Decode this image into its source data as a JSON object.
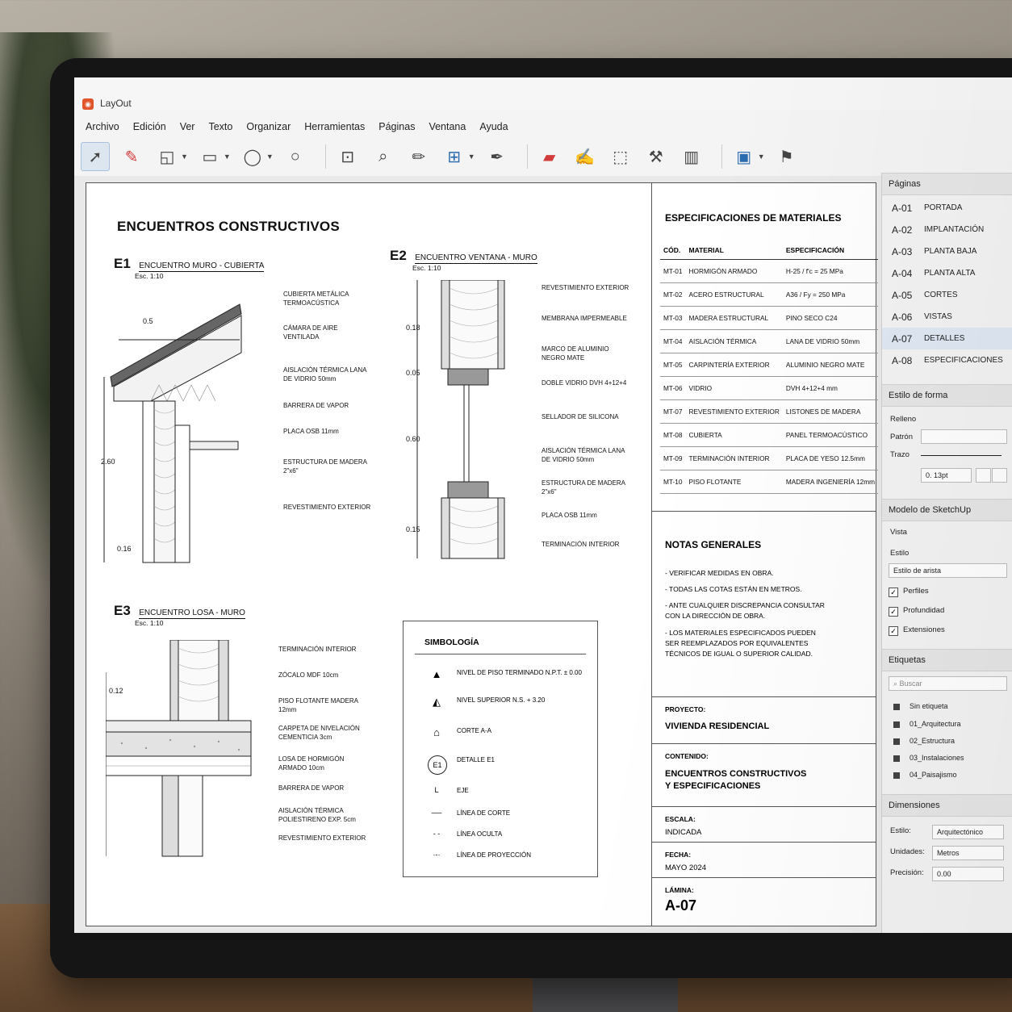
{
  "app": {
    "title": "LayOut"
  },
  "menu": [
    "Archivo",
    "Edición",
    "Ver",
    "Texto",
    "Organizar",
    "Herramientas",
    "Páginas",
    "Ventana",
    "Ayuda"
  ],
  "drawing": {
    "title": "ENCUENTROS CONSTRUCTIVOS",
    "e1": {
      "code": "E1",
      "name": "ENCUENTRO MURO - CUBIERTA",
      "scale": "Esc. 1:10",
      "labels": [
        "CUBIERTA METÁLICA TERMOACÚSTICA",
        "CÁMARA DE AIRE VENTILADA",
        "AISLACIÓN TÉRMICA LANA DE VIDRIO 50mm",
        "BARRERA DE VAPOR",
        "PLACA OSB 11mm",
        "ESTRUCTURA DE MADERA 2\"x6\"",
        "REVESTIMIENTO EXTERIOR"
      ],
      "dims": [
        "0.5",
        "2.60",
        "0.16"
      ]
    },
    "e2": {
      "code": "E2",
      "name": "ENCUENTRO VENTANA - MURO",
      "scale": "Esc. 1:10",
      "labels": [
        "REVESTIMIENTO EXTERIOR",
        "MEMBRANA IMPERMEABLE",
        "MARCO DE ALUMINIO NEGRO MATE",
        "DOBLE VIDRIO DVH 4+12+4",
        "SELLADOR DE SILICONA",
        "AISLACIÓN TÉRMICA LANA DE VIDRIO 50mm",
        "ESTRUCTURA DE MADERA 2\"x6\"",
        "PLACA OSB 11mm",
        "TERMINACIÓN INTERIOR"
      ],
      "dims": [
        "0.18",
        "0.05",
        "0.60",
        "0.15"
      ]
    },
    "e3": {
      "code": "E3",
      "name": "ENCUENTRO LOSA - MURO",
      "scale": "Esc. 1:10",
      "labels": [
        "TERMINACIÓN INTERIOR",
        "ZÓCALO MDF 10cm",
        "PISO FLOTANTE MADERA 12mm",
        "CARPETA DE NIVELACIÓN CEMENTICIA 3cm",
        "LOSA DE HORMIGÓN ARMADO 10cm",
        "BARRERA DE VAPOR",
        "AISLACIÓN TÉRMICA POLIESTIRENO EXP. 5cm",
        "REVESTIMIENTO EXTERIOR"
      ],
      "dims": [
        "0.12"
      ]
    },
    "symbology": {
      "title": "SIMBOLOGÍA",
      "items": [
        {
          "glyph": "▲",
          "text": "NIVEL DE PISO TERMINADO N.P.T. ± 0.00"
        },
        {
          "glyph": "◭",
          "text": "NIVEL SUPERIOR N.S. + 3.20"
        },
        {
          "glyph": "⌂",
          "text": "CORTE A-A"
        },
        {
          "glyph": "E1",
          "text": "DETALLE E1"
        },
        {
          "glyph": "L",
          "text": "EJE"
        },
        {
          "glyph": "──",
          "text": "LÍNEA DE CORTE"
        },
        {
          "glyph": "- -",
          "text": "LÍNEA OCULTA"
        },
        {
          "glyph": "·-·",
          "text": "LÍNEA DE PROYECCIÓN"
        }
      ]
    }
  },
  "specs": {
    "title": "ESPECIFICACIONES DE MATERIALES",
    "headers": [
      "CÓD.",
      "MATERIAL",
      "ESPECIFICACIÓN"
    ],
    "rows": [
      [
        "MT-01",
        "HORMIGÓN ARMADO",
        "H-25 / f'c = 25 MPa"
      ],
      [
        "MT-02",
        "ACERO ESTRUCTURAL",
        "A36 / Fy = 250 MPa"
      ],
      [
        "MT-03",
        "MADERA ESTRUCTURAL",
        "PINO SECO C24"
      ],
      [
        "MT-04",
        "AISLACIÓN TÉRMICA",
        "LANA DE VIDRIO 50mm"
      ],
      [
        "MT-05",
        "CARPINTERÍA EXTERIOR",
        "ALUMINIO NEGRO MATE"
      ],
      [
        "MT-06",
        "VIDRIO",
        "DVH 4+12+4 mm"
      ],
      [
        "MT-07",
        "REVESTIMIENTO EXTERIOR",
        "LISTONES DE MADERA"
      ],
      [
        "MT-08",
        "CUBIERTA",
        "PANEL TERMOACÚSTICO"
      ],
      [
        "MT-09",
        "TERMINACIÓN INTERIOR",
        "PLACA DE YESO 12.5mm"
      ],
      [
        "MT-10",
        "PISO FLOTANTE",
        "MADERA INGENIERÍA 12mm"
      ]
    ]
  },
  "notes": {
    "title": "NOTAS GENERALES",
    "items": [
      "- VERIFICAR MEDIDAS EN OBRA.",
      "- TODAS LAS COTAS ESTÁN EN METROS.",
      "- ANTE CUALQUIER DISCREPANCIA CONSULTAR CON LA DIRECCIÓN DE OBRA.",
      "- LOS MATERIALES ESPECIFICADOS PUEDEN SER REEMPLAZADOS POR EQUIVALENTES TÉCNICOS DE IGUAL O SUPERIOR CALIDAD."
    ]
  },
  "titleblock": {
    "proyecto_label": "PROYECTO:",
    "proyecto": "VIVIENDA RESIDENCIAL",
    "contenido_label": "CONTENIDO:",
    "contenido": "ENCUENTROS CONSTRUCTIVOS Y ESPECIFICACIONES",
    "escala_label": "ESCALA:",
    "escala": "INDICADA",
    "fecha_label": "FECHA:",
    "fecha": "MAYO 2024",
    "lamina_label": "LÁMINA:",
    "lamina": "A-07"
  },
  "panel": {
    "pages_title": "Páginas",
    "pages": [
      {
        "code": "A-01",
        "name": "PORTADA"
      },
      {
        "code": "A-02",
        "name": "IMPLANTACIÓN"
      },
      {
        "code": "A-03",
        "name": "PLANTA BAJA"
      },
      {
        "code": "A-04",
        "name": "PLANTA ALTA"
      },
      {
        "code": "A-05",
        "name": "CORTES"
      },
      {
        "code": "A-06",
        "name": "VISTAS"
      },
      {
        "code": "A-07",
        "name": "DETALLES"
      },
      {
        "code": "A-08",
        "name": "ESPECIFICACIONES"
      }
    ],
    "shape_title": "Estilo de forma",
    "relleno": "Relleno",
    "patron": "Patrón",
    "trazo": "Trazo",
    "stroke_width": "0. 13pt",
    "model_title": "Modelo de SketchUp",
    "vista": "Vista",
    "estilo": "Estilo",
    "estilo_value": "Estilo de arista",
    "checks": [
      "Perfiles",
      "Profundidad",
      "Extensiones"
    ],
    "tags_title": "Etiquetas",
    "tags_search": "Buscar",
    "tags": [
      "Sin etiqueta",
      "01_Arquitectura",
      "02_Estructura",
      "03_Instalaciones",
      "04_Paisajismo"
    ],
    "dims_title": "Dimensiones",
    "dims_estilo_label": "Estilo:",
    "dims_estilo": "Arquitectónico",
    "dims_unidades_label": "Unidades:",
    "dims_unidades": "Metros",
    "dims_precision_label": "Precisión:",
    "dims_precision": "0.00"
  }
}
